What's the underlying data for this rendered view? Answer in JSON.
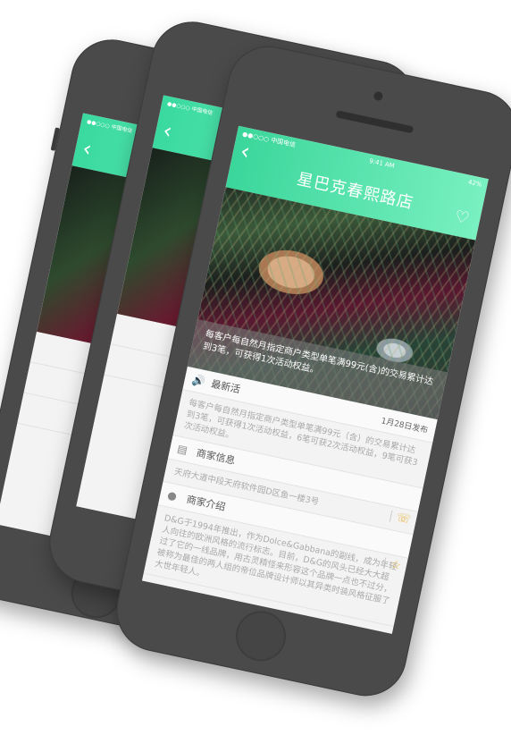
{
  "status": {
    "carrier": "●●○○○ 中国电信",
    "time": "9:41 AM",
    "battery": "42%"
  },
  "header": {
    "title": "星巴克春熙路店",
    "back_icon": "chevron-left-icon",
    "fav_icon": "heart-icon"
  },
  "banner": {
    "caption": "每客户每自然月指定商户类型单笔满99元(含)的交易累计达到3笔，可获得1次活动权益。"
  },
  "latest": {
    "label": "最新活",
    "date": "1月28日发布",
    "body": "每客户每自然月指定商户类型单笔满99元（含）的交易累计达到3笔，可获得1次活动权益，6笔可获2次活动权益，9笔可获3次活动权益。"
  },
  "merchant_info": {
    "label": "商家信息",
    "address": "天府大道中段天府软件园D区鱼一楼3号"
  },
  "merchant_intro": {
    "label": "商家介绍",
    "body": "D&G于1994年推出，作为Dolce&Gabbana的副线，成为年轻人向往的欧洲风格的流行标志。目前，D&G的风头已经大大超过了它的一线品牌，用古灵精怪来形容这个品牌一点也不过分，被称为最佳的两人组的帝位品牌设计师以其异类时装风格征服了大世年轻人。"
  },
  "colors": {
    "accent_start": "#3ad69a",
    "accent_end": "#79f0c0",
    "icon_accent": "#e8b84a"
  }
}
